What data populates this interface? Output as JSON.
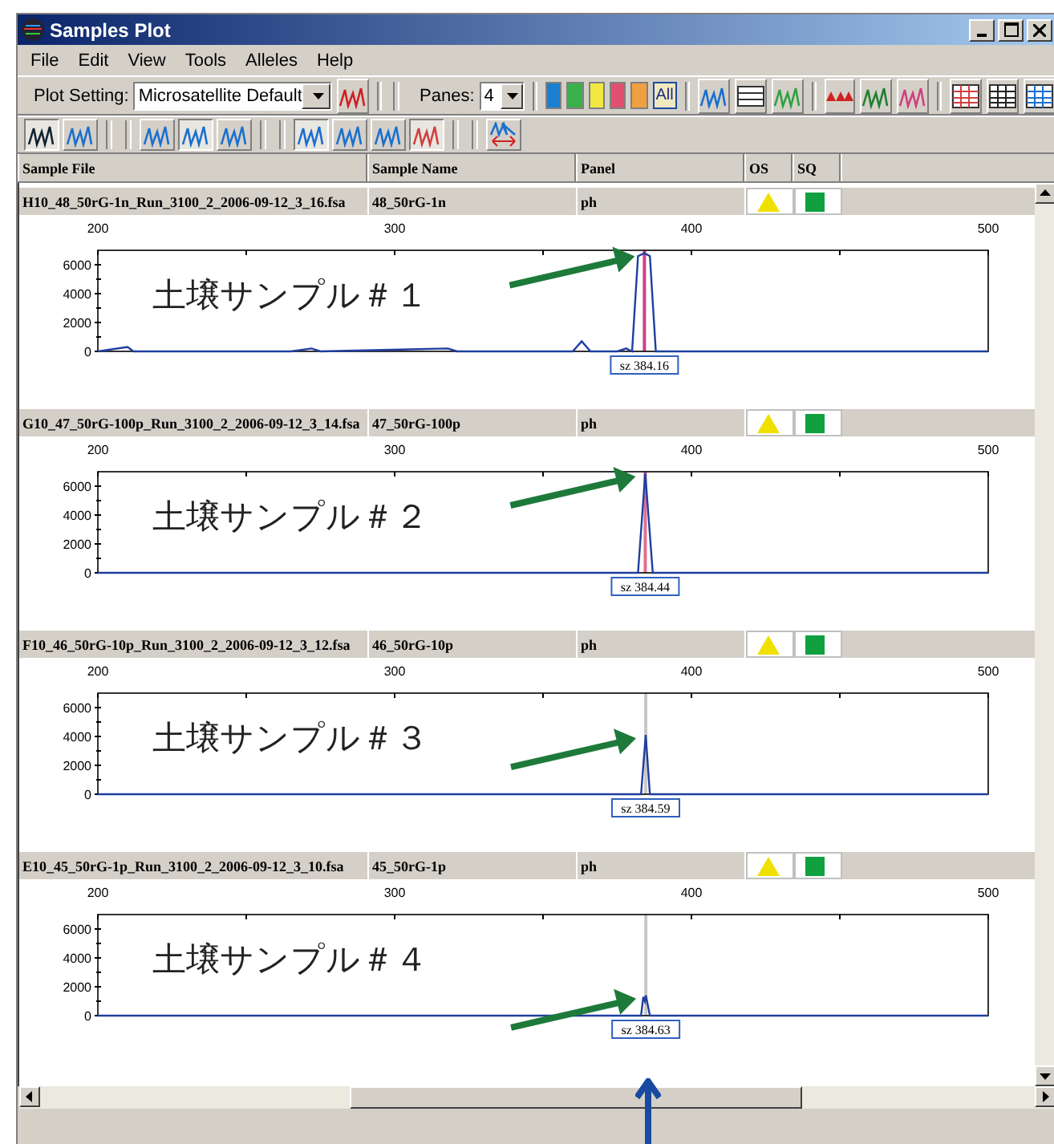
{
  "window": {
    "title": "Samples Plot"
  },
  "menu": [
    "File",
    "Edit",
    "View",
    "Tools",
    "Alleles",
    "Help"
  ],
  "toolbar": {
    "plot_setting_label": "Plot Setting:",
    "plot_setting": "Microsatellite Default",
    "panes_label": "Panes:",
    "panes": "4",
    "dyes": [
      {
        "color": "#1a7fd0"
      },
      {
        "color": "#3cb04a"
      },
      {
        "color": "#f0e840"
      },
      {
        "color": "#e05070"
      },
      {
        "color": "#f0a040"
      }
    ],
    "all_dyes": "All"
  },
  "columns": [
    "Sample File",
    "Sample Name",
    "Panel",
    "OS",
    "SQ"
  ],
  "panes": [
    {
      "sample_file": "H10_48_50rG-1n_Run_3100_2_2006-09-12_3_16.fsa",
      "sample_name": "48_50rG-1n",
      "panel": "ph",
      "caption": "土壌サンプル＃１",
      "chart_data": {
        "type": "line",
        "xlim": [
          200,
          500
        ],
        "ylim": [
          0,
          7000
        ],
        "xticks": [
          200,
          300,
          400,
          500
        ],
        "yticks": [
          0,
          2000,
          4000,
          6000
        ],
        "series": [
          {
            "color": "#1f3f9f",
            "values": [
              0,
              300,
              0,
              0,
              200,
              0,
              200,
              0,
              0,
              700,
              0,
              0,
              200,
              0,
              6600,
              6800,
              6600,
              0,
              0,
              0
            ],
            "x": [
              200,
              210,
              212,
              265,
              272,
              275,
              318,
              321,
              360,
              363,
              366,
              375,
              378,
              380,
              382,
              384.16,
              386,
              388,
              390,
              500
            ]
          }
        ],
        "ref_lines": [
          {
            "axis": "x",
            "value": 384.16,
            "color": "#d0408a"
          }
        ],
        "annotations": [
          "sz 384.16"
        ]
      }
    },
    {
      "sample_file": "G10_47_50rG-100p_Run_3100_2_2006-09-12_3_14.fsa",
      "sample_name": "47_50rG-100p",
      "panel": "ph",
      "caption": "土壌サンプル＃２",
      "chart_data": {
        "type": "line",
        "xlim": [
          200,
          500
        ],
        "ylim": [
          0,
          7000
        ],
        "xticks": [
          200,
          300,
          400,
          500
        ],
        "yticks": [
          0,
          2000,
          4000,
          6000
        ],
        "series": [
          {
            "color": "#1f3f9f",
            "values": [
              0,
              0,
              0,
              6900,
              0,
              0,
              0
            ],
            "x": [
              200,
              380,
              382,
              384.44,
              387,
              389,
              500
            ]
          }
        ],
        "ref_lines": [
          {
            "axis": "x",
            "value": 384.44,
            "color": "#e07090"
          }
        ],
        "annotations": [
          "sz 384.44"
        ]
      }
    },
    {
      "sample_file": "F10_46_50rG-10p_Run_3100_2_2006-09-12_3_12.fsa",
      "sample_name": "46_50rG-10p",
      "panel": "ph",
      "caption": "土壌サンプル＃３",
      "chart_data": {
        "type": "line",
        "xlim": [
          200,
          500
        ],
        "ylim": [
          0,
          7000
        ],
        "xticks": [
          200,
          300,
          400,
          500
        ],
        "yticks": [
          0,
          2000,
          4000,
          6000
        ],
        "series": [
          {
            "color": "#1f3f9f",
            "values": [
              0,
              0,
              0,
              4100,
              0,
              0
            ],
            "x": [
              200,
              382,
              383,
              384.59,
              386,
              500
            ]
          }
        ],
        "ref_lines": [
          {
            "axis": "x",
            "value": 384.59,
            "color": "#c8c8c8"
          }
        ],
        "annotations": [
          "sz 384.59"
        ]
      }
    },
    {
      "sample_file": "E10_45_50rG-1p_Run_3100_2_2006-09-12_3_10.fsa",
      "sample_name": "45_50rG-1p",
      "panel": "ph",
      "caption": "土壌サンプル＃４",
      "chart_data": {
        "type": "line",
        "xlim": [
          200,
          500
        ],
        "ylim": [
          0,
          7000
        ],
        "xticks": [
          200,
          300,
          400,
          500
        ],
        "yticks": [
          0,
          2000,
          4000,
          6000
        ],
        "series": [
          {
            "color": "#1f3f9f",
            "values": [
              0,
              0,
              0,
              1300,
              1000,
              1400,
              0,
              0
            ],
            "x": [
              200,
              382,
              383,
              383.8,
              384.3,
              384.63,
              386,
              500
            ]
          }
        ],
        "ref_lines": [
          {
            "axis": "x",
            "value": 384.63,
            "color": "#c8c8c8"
          }
        ],
        "annotations": [
          "sz 384.63"
        ]
      }
    }
  ]
}
